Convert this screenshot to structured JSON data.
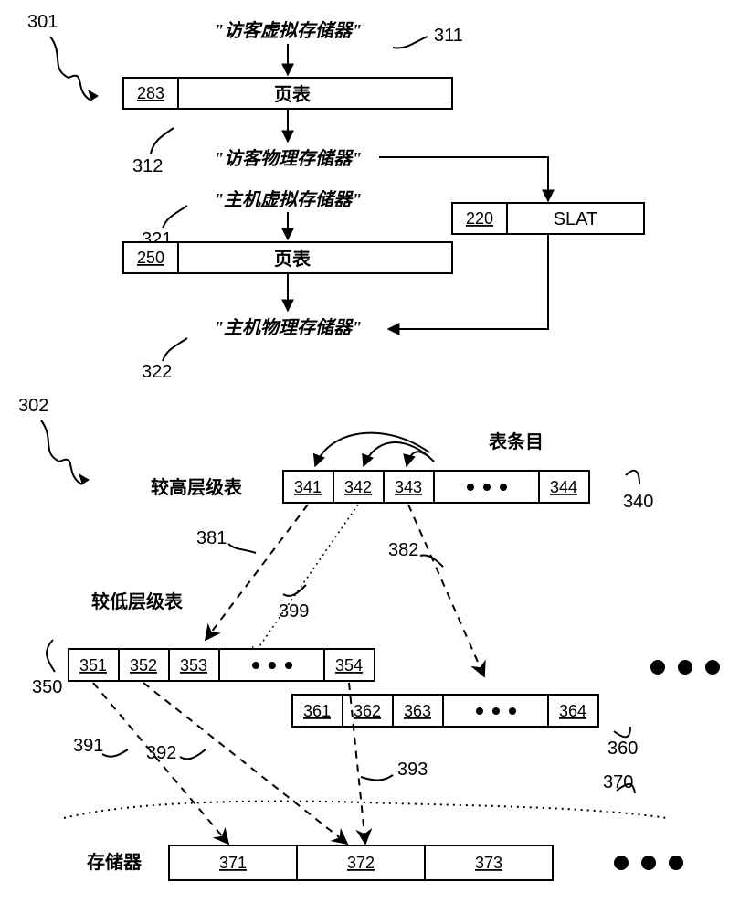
{
  "fig_top_ref": "301",
  "fig_bot_ref": "302",
  "guest_virtual_label": "\"访客虚拟存储器\"",
  "guest_virtual_ref": "311",
  "pt1_num": "283",
  "pt1_label": "页表",
  "guest_physical_label": "\"访客物理存储器\"",
  "guest_physical_ref": "312",
  "host_virtual_label": "\"主机虚拟存储器\"",
  "host_virtual_ref": "321",
  "pt2_num": "250",
  "pt2_label": "页表",
  "slat_num": "220",
  "slat_label": "SLAT",
  "host_physical_label": "\"主机物理存储器\"",
  "host_physical_ref": "322",
  "higher_label": "较高层级表",
  "lower_label": "较低层级表",
  "memory_label": "存储器",
  "entries_label": "表条目",
  "t340_ref": "340",
  "t340_c1": "341",
  "t340_c2": "342",
  "t340_c3": "343",
  "t340_c4": "344",
  "t350_ref": "350",
  "t350_c1": "351",
  "t350_c2": "352",
  "t350_c3": "353",
  "t350_c4": "354",
  "t360_ref": "360",
  "t360_c1": "361",
  "t360_c2": "362",
  "t360_c3": "363",
  "t360_c4": "364",
  "mem_ref": "370",
  "mem_c1": "371",
  "mem_c2": "372",
  "mem_c3": "373",
  "arc381": "381",
  "arc382": "382",
  "arc399": "399",
  "arc391": "391",
  "arc392": "392",
  "arc393": "393",
  "chart_data": {
    "type": "table",
    "note": "Two schematic diagrams; no quantitative axes.",
    "diagram_301": {
      "nodes": [
        {
          "id": "guest_virtual",
          "label": "访客虚拟存储器",
          "ref": "311"
        },
        {
          "id": "page_table_283",
          "label": "页表",
          "num": "283"
        },
        {
          "id": "guest_physical",
          "label": "访客物理存储器",
          "ref": "312"
        },
        {
          "id": "host_virtual",
          "label": "主机虚拟存储器",
          "ref": "321"
        },
        {
          "id": "page_table_250",
          "label": "页表",
          "num": "250"
        },
        {
          "id": "slat_220",
          "label": "SLAT",
          "num": "220"
        },
        {
          "id": "host_physical",
          "label": "主机物理存储器",
          "ref": "322"
        }
      ],
      "edges": [
        [
          "guest_virtual",
          "page_table_283"
        ],
        [
          "page_table_283",
          "guest_physical"
        ],
        [
          "guest_physical",
          "slat_220"
        ],
        [
          "slat_220",
          "host_physical"
        ],
        [
          "host_virtual",
          "page_table_250"
        ],
        [
          "page_table_250",
          "host_physical"
        ]
      ]
    },
    "diagram_302": {
      "higher_table": {
        "ref": "340",
        "entries": [
          "341",
          "342",
          "343",
          "344"
        ]
      },
      "lower_tables": [
        {
          "ref": "350",
          "entries": [
            "351",
            "352",
            "353",
            "354"
          ]
        },
        {
          "ref": "360",
          "entries": [
            "361",
            "362",
            "363",
            "364"
          ]
        }
      ],
      "memory": {
        "ref": "370",
        "pages": [
          "371",
          "372",
          "373"
        ]
      },
      "higher_to_lower_edges": [
        {
          "ref": "381",
          "from": "341",
          "to_table": "350"
        },
        {
          "ref": "399",
          "from": "342",
          "to_table": "350",
          "note": "dotted"
        },
        {
          "ref": "382",
          "from": "343",
          "to_table": "360"
        }
      ],
      "lower_to_memory_edges": [
        {
          "ref": "391",
          "from": "351",
          "to": "371"
        },
        {
          "ref": "392",
          "from": "352",
          "to": "372"
        },
        {
          "ref": "393",
          "from": "354",
          "to": "372"
        }
      ]
    }
  }
}
